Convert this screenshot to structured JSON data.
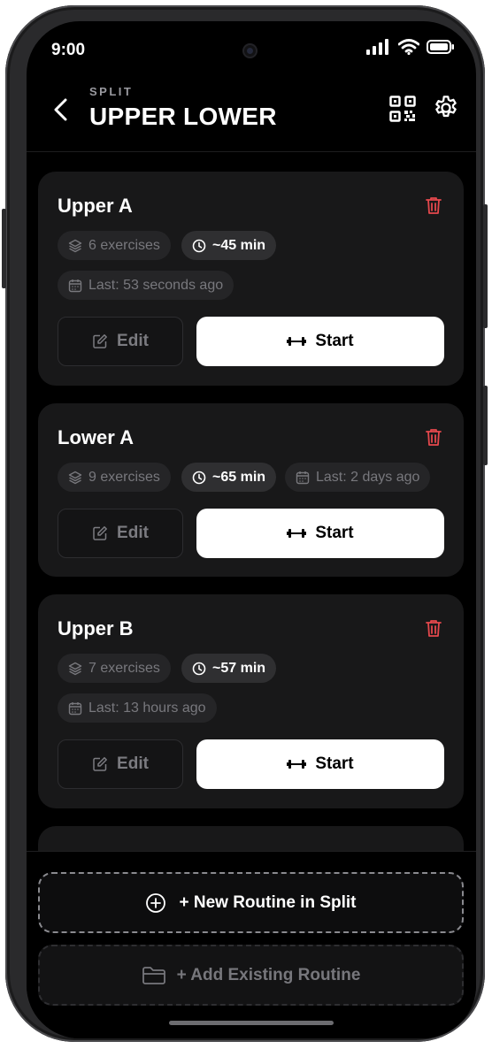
{
  "status_bar": {
    "time": "9:00"
  },
  "header": {
    "eyebrow": "SPLIT",
    "title": "UPPER LOWER"
  },
  "routines": [
    {
      "name": "Upper A",
      "exercises": "6 exercises",
      "duration": "~45 min",
      "last": "Last: 53 seconds ago",
      "edit_label": "Edit",
      "start_label": "Start"
    },
    {
      "name": "Lower A",
      "exercises": "9 exercises",
      "duration": "~65 min",
      "last": "Last: 2 days ago",
      "edit_label": "Edit",
      "start_label": "Start"
    },
    {
      "name": "Upper B",
      "exercises": "7 exercises",
      "duration": "~57 min",
      "last": "Last: 13 hours ago",
      "edit_label": "Edit",
      "start_label": "Start"
    }
  ],
  "actions": {
    "new_routine": "+ New Routine in Split",
    "add_existing": "+ Add Existing Routine"
  },
  "colors": {
    "background": "#000000",
    "card": "#181819",
    "delete": "#e5484d",
    "primary_button": "#ffffff"
  }
}
